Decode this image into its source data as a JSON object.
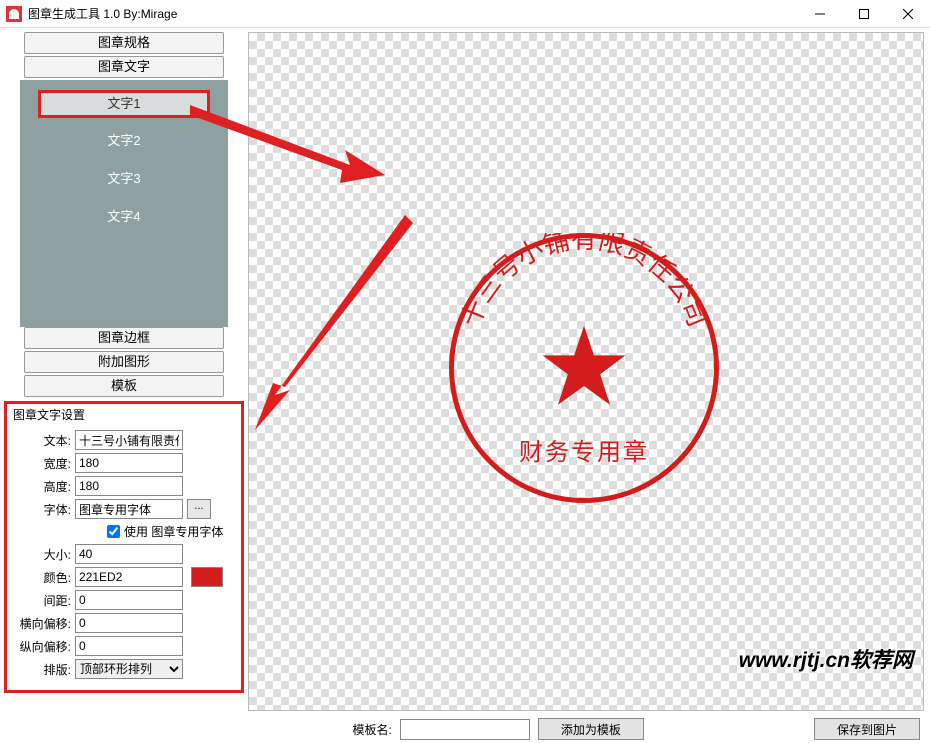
{
  "window": {
    "title": "图章生成工具 1.0    By:Mirage"
  },
  "accordion": {
    "spec": "图章规格",
    "text": "图章文字",
    "border": "图章边框",
    "shape": "附加图形",
    "template": "模板"
  },
  "textItems": [
    "文字1",
    "文字2",
    "文字3",
    "文字4"
  ],
  "settings": {
    "title": "图章文字设置",
    "labels": {
      "text": "文本:",
      "width": "宽度:",
      "height": "高度:",
      "font": "字体:",
      "useFont": "使用 图章专用字体",
      "size": "大小:",
      "color": "颜色:",
      "spacing": "间距:",
      "hoff": "横向偏移:",
      "voff": "纵向偏移:",
      "layout": "排版:"
    },
    "values": {
      "text": "十三号小铺有限责任",
      "width": "180",
      "height": "180",
      "font": "图章专用字体",
      "fontBtn": "...",
      "size": "40",
      "color": "221ED2",
      "spacing": "0",
      "hoff": "0",
      "voff": "0",
      "layout": "顶部环形排列"
    },
    "colorHex": "#d31d1d"
  },
  "stamp": {
    "arcText": "十三号小铺有限责任公司",
    "bottomText": "财务专用章"
  },
  "bottom": {
    "tplLabel": "模板名:",
    "addTpl": "添加为模板",
    "saveImg": "保存到图片"
  },
  "watermark": "www.rjtj.cn软荐网"
}
